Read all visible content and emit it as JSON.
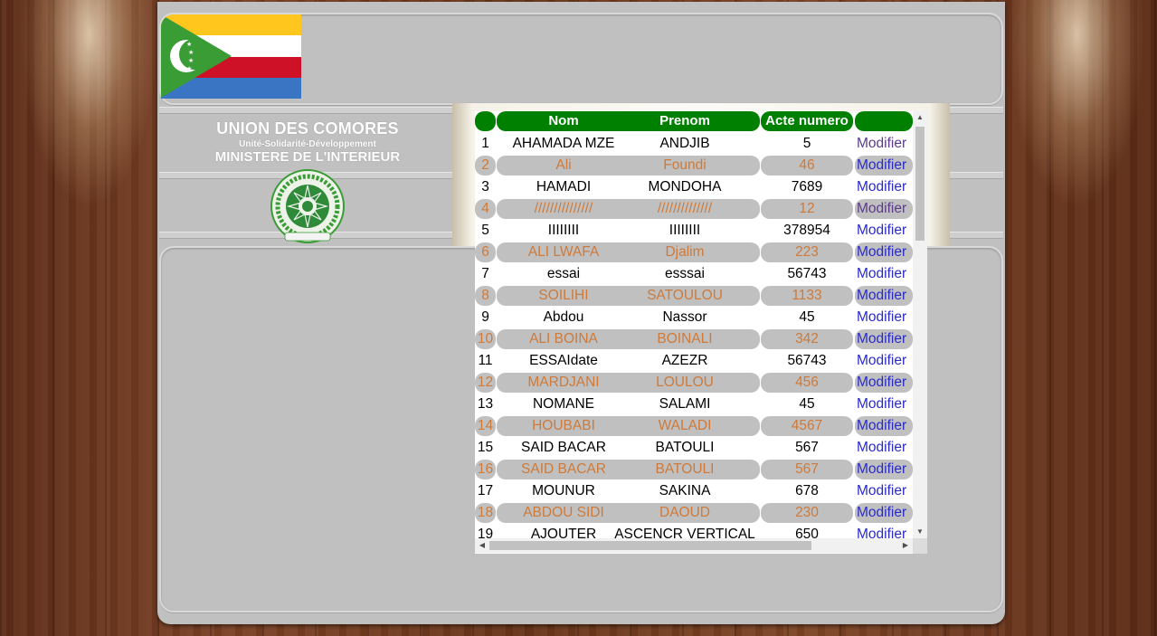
{
  "header": {
    "title": "UNION DES COMORES",
    "motto": "Unité-Solidarité-Développement",
    "ministry": "MINISTERE DE L'INTERIEUR",
    "flag_colors": [
      "#ffc61e",
      "#ffffff",
      "#ce1126",
      "#3a75c4",
      "#3a9c35"
    ],
    "emblem_icon": "coat-of-arms-seal"
  },
  "table": {
    "columns": [
      "",
      "Nom",
      "Prenom",
      "Acte numero",
      ""
    ],
    "action_label": "Modifier",
    "header_color": "#008000",
    "alt_row_text_color": "#cd7a3a",
    "rows": [
      {
        "id": "1",
        "nom": "AHAMADA MZE",
        "prenom": "ANDJIB",
        "acte": "5"
      },
      {
        "id": "2",
        "nom": "Ali",
        "prenom": "Foundi",
        "acte": "46"
      },
      {
        "id": "3",
        "nom": "HAMADI",
        "prenom": "MONDOHA",
        "acte": "7689"
      },
      {
        "id": "4",
        "nom": "///////////////",
        "prenom": "//////////////",
        "acte": "12"
      },
      {
        "id": "5",
        "nom": "IIIIIIII",
        "prenom": "IIIIIIII",
        "acte": "378954"
      },
      {
        "id": "6",
        "nom": "ALI LWAFA",
        "prenom": "Djalim",
        "acte": "223"
      },
      {
        "id": "7",
        "nom": "essai",
        "prenom": "esssai",
        "acte": "56743"
      },
      {
        "id": "8",
        "nom": "SOILIHI",
        "prenom": "SATOULOU",
        "acte": "1133"
      },
      {
        "id": "9",
        "nom": "Abdou",
        "prenom": "Nassor",
        "acte": "45"
      },
      {
        "id": "10",
        "nom": "ALI BOINA",
        "prenom": "BOINALI",
        "acte": "342"
      },
      {
        "id": "11",
        "nom": "ESSAIdate",
        "prenom": "AZEZR",
        "acte": "56743"
      },
      {
        "id": "12",
        "nom": "MARDJANI",
        "prenom": "LOULOU",
        "acte": "456"
      },
      {
        "id": "13",
        "nom": "NOMANE",
        "prenom": "SALAMI",
        "acte": "45"
      },
      {
        "id": "14",
        "nom": "HOUBABI",
        "prenom": "WALADI",
        "acte": "4567"
      },
      {
        "id": "15",
        "nom": "SAID BACAR",
        "prenom": "BATOULI",
        "acte": "567"
      },
      {
        "id": "16",
        "nom": "SAID BACAR",
        "prenom": "BATOULI",
        "acte": "567"
      },
      {
        "id": "17",
        "nom": "MOUNUR",
        "prenom": "SAKINA",
        "acte": "678"
      },
      {
        "id": "18",
        "nom": "ABDOU SIDI",
        "prenom": "DAOUD",
        "acte": "230"
      },
      {
        "id": "19",
        "nom": "AJOUTER",
        "prenom": "ASCENCR VERTICAL",
        "acte": "650"
      }
    ]
  }
}
